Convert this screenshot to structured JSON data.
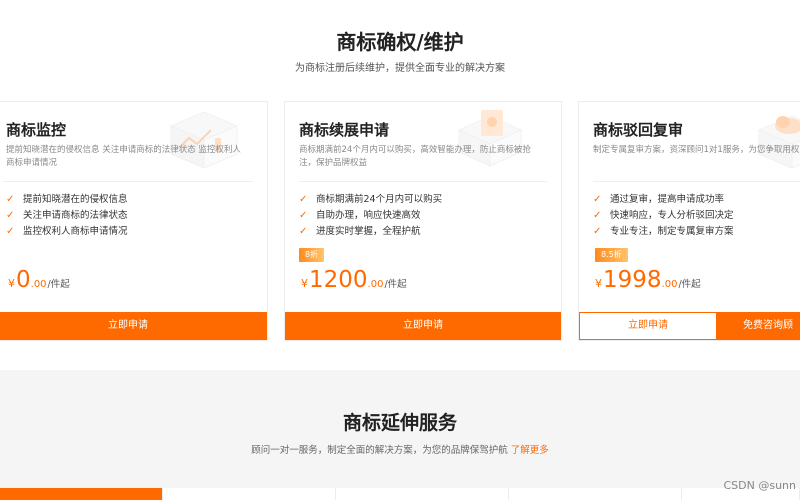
{
  "header": {
    "title": "商标确权/维护",
    "subtitle": "为商标注册后续维护，提供全面专业的解决方案"
  },
  "cards": [
    {
      "title": "商标监控",
      "description": "提前知晓潜在的侵权信息 关注申请商标的法律状态 监控权利人商标申请情况",
      "features": [
        "提前知晓潜在的侵权信息",
        "关注申请商标的法律状态",
        "监控权利人商标申请情况"
      ],
      "discount": "",
      "price": {
        "currency": "¥",
        "integer": "0",
        "decimal": ".00",
        "unit": "/件起"
      },
      "button": "立即申请"
    },
    {
      "title": "商标续展申请",
      "description": "商标期满前24个月内可以购买，高效智能办理，防止商标被抢注，保护品牌权益",
      "features": [
        "商标期满前24个月内可以购买",
        "自助办理，响应快速高效",
        "进度实时掌握，全程护航"
      ],
      "discount": "8折",
      "price": {
        "currency": "¥",
        "integer": "1200",
        "decimal": ".00",
        "unit": "/件起"
      },
      "button": "立即申请"
    },
    {
      "title": "商标驳回复审",
      "description": "制定专属复审方案，资深顾问1对1服务，为您争取用权",
      "features": [
        "通过复审，提高申请成功率",
        "快速响应，专人分析驳回决定",
        "专业专注，制定专属复审方案"
      ],
      "discount": "8.5折",
      "price": {
        "currency": "¥",
        "integer": "1998",
        "decimal": ".00",
        "unit": "/件起"
      },
      "button": "立即申请",
      "consult_button": "免费咨询顾"
    }
  ],
  "extension": {
    "title": "商标延伸服务",
    "subtitle": "顾问一对一服务，制定全面的解决方案，为您的品牌保驾护航",
    "more_link": "了解更多",
    "tab_states": [
      true,
      false,
      false,
      false,
      false
    ]
  },
  "watermark": "CSDN @sunn",
  "icons": {
    "check": "check-icon"
  },
  "colors": {
    "accent": "#ff6a00",
    "background_alt": "#f5f5f6"
  }
}
